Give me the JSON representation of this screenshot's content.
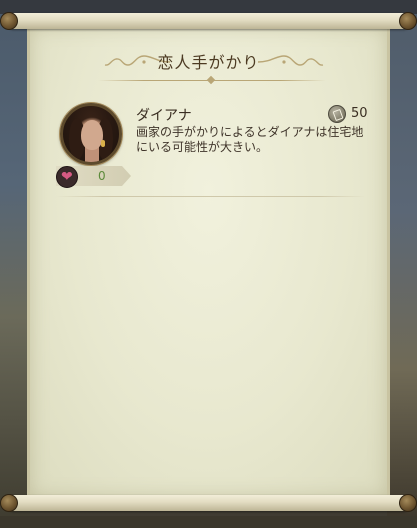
{
  "panel": {
    "title": "恋人手がかり"
  },
  "entries": [
    {
      "name": "ダイアナ",
      "cost": "50",
      "cost_icon": "clue-token-icon",
      "description": "画家の手がかりによるとダイアナは住宅地にいる可能性が大きい。",
      "affinity_icon": "heart-icon",
      "affinity_value": "0"
    }
  ],
  "colors": {
    "paper": "#e8e8cf",
    "title_text": "#4c3a22",
    "affinity_value": "#5c8a3a",
    "heart": "#d65a83"
  }
}
